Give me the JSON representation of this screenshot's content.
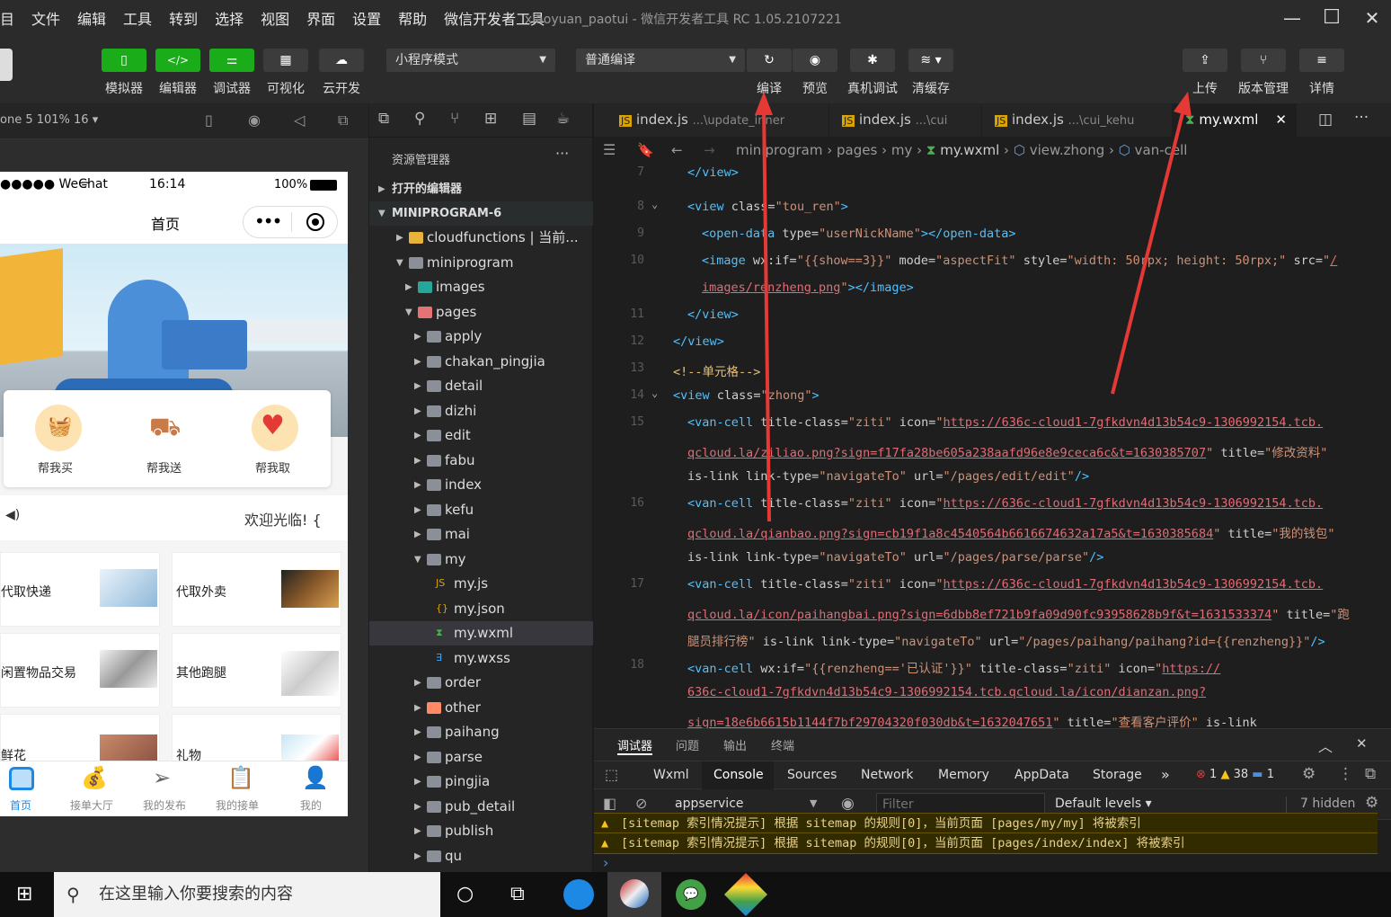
{
  "menu": [
    "目",
    "文件",
    "编辑",
    "工具",
    "转到",
    "选择",
    "视图",
    "界面",
    "设置",
    "帮助",
    "微信开发者工具"
  ],
  "window_title": "xiaoyuan_paotui - 微信开发者工具 RC 1.05.2107221",
  "toolbar": {
    "simulator": "模拟器",
    "editor": "编辑器",
    "debugger": "调试器",
    "visual": "可视化",
    "cloud": "云开发",
    "mode_select": "小程序模式",
    "compile_select": "普通编译",
    "compile": "编译",
    "preview": "预览",
    "real_debug": "真机调试",
    "clear_cache": "清缓存",
    "upload": "上传",
    "version": "版本管理",
    "details": "详情"
  },
  "sim_device": "one 5 101% 16 ▾",
  "phone": {
    "carrier": "●●●●● WeChat",
    "time": "16:14",
    "battery": "100%",
    "nav_title": "首页",
    "services": [
      "帮我买",
      "帮我送",
      "帮我取"
    ],
    "notice": "欢迎光临! {",
    "grid": [
      "代取快递",
      "代取外卖",
      "闲置物品交易",
      "其他跑腿",
      "鲜花",
      "礼物"
    ],
    "tabbar": [
      "首页",
      "接单大厅",
      "我的发布",
      "我的接单",
      "我的"
    ]
  },
  "explorer": {
    "title": "资源管理器",
    "open_editors": "打开的编辑器",
    "project": "MINIPROGRAM-6",
    "items": [
      {
        "label": "cloudfunctions | 当前...",
        "depth": 1,
        "kind": "folder-yellow",
        "arrow": "▶"
      },
      {
        "label": "miniprogram",
        "depth": 1,
        "kind": "folder",
        "arrow": "▼"
      },
      {
        "label": "images",
        "depth": 2,
        "kind": "folder-teal",
        "arrow": "▶"
      },
      {
        "label": "pages",
        "depth": 2,
        "kind": "folder-red",
        "arrow": "▼"
      },
      {
        "label": "apply",
        "depth": 3,
        "kind": "folder",
        "arrow": "▶"
      },
      {
        "label": "chakan_pingjia",
        "depth": 3,
        "kind": "folder",
        "arrow": "▶"
      },
      {
        "label": "detail",
        "depth": 3,
        "kind": "folder",
        "arrow": "▶"
      },
      {
        "label": "dizhi",
        "depth": 3,
        "kind": "folder",
        "arrow": "▶"
      },
      {
        "label": "edit",
        "depth": 3,
        "kind": "folder",
        "arrow": "▶"
      },
      {
        "label": "fabu",
        "depth": 3,
        "kind": "folder",
        "arrow": "▶"
      },
      {
        "label": "index",
        "depth": 3,
        "kind": "folder",
        "arrow": "▶"
      },
      {
        "label": "kefu",
        "depth": 3,
        "kind": "folder",
        "arrow": "▶"
      },
      {
        "label": "mai",
        "depth": 3,
        "kind": "folder",
        "arrow": "▶"
      },
      {
        "label": "my",
        "depth": 3,
        "kind": "folder",
        "arrow": "▼"
      },
      {
        "label": "my.js",
        "depth": 4,
        "kind": "js",
        "arrow": ""
      },
      {
        "label": "my.json",
        "depth": 4,
        "kind": "json",
        "arrow": ""
      },
      {
        "label": "my.wxml",
        "depth": 4,
        "kind": "wxml",
        "arrow": ""
      },
      {
        "label": "my.wxss",
        "depth": 4,
        "kind": "wxss",
        "arrow": ""
      },
      {
        "label": "order",
        "depth": 3,
        "kind": "folder",
        "arrow": "▶"
      },
      {
        "label": "other",
        "depth": 3,
        "kind": "folder-orange",
        "arrow": "▶"
      },
      {
        "label": "paihang",
        "depth": 3,
        "kind": "folder",
        "arrow": "▶"
      },
      {
        "label": "parse",
        "depth": 3,
        "kind": "folder",
        "arrow": "▶"
      },
      {
        "label": "pingjia",
        "depth": 3,
        "kind": "folder",
        "arrow": "▶"
      },
      {
        "label": "pub_detail",
        "depth": 3,
        "kind": "folder",
        "arrow": "▶"
      },
      {
        "label": "publish",
        "depth": 3,
        "kind": "folder",
        "arrow": "▶"
      },
      {
        "label": "qu",
        "depth": 3,
        "kind": "folder",
        "arrow": "▶"
      }
    ]
  },
  "tabs": [
    {
      "name": "index.js",
      "path": "...\\update_inner"
    },
    {
      "name": "index.js",
      "path": "...\\cui"
    },
    {
      "name": "index.js",
      "path": "...\\cui_kehu"
    },
    {
      "name": "my.wxml",
      "path": ""
    }
  ],
  "breadcrumb": [
    "miniprogram",
    "pages",
    "my",
    "my.wxml",
    "view.zhong",
    "van-cell"
  ],
  "code_lines": [
    {
      "n": "",
      "html": "<span class='tg'>&lt;/view&gt;</span>",
      "indent": 1
    },
    {
      "n": "8",
      "html": "<span class='tg'>&lt;view</span> <span class='at'>class=</span><span class='sv'>\"tou_ren\"</span><span class='tg'>&gt;</span>",
      "indent": 1
    },
    {
      "n": "9",
      "html": "<span class='tg'>&lt;open-data</span> <span class='at'>type=</span><span class='sv'>\"userNickName\"</span><span class='tg'>&gt;&lt;/open-data&gt;</span>",
      "indent": 2
    },
    {
      "n": "10",
      "html": "<span class='tg'>&lt;image</span> <span class='at'>wx:if=</span><span class='sv'>\"{{show==3}}\"</span> <span class='at'>mode=</span><span class='sv'>\"aspectFit\"</span> <span class='at'>style=</span><span class='sv'>\"width: 50rpx; height: 50rpx;\"</span> <span class='at'>src=</span><span class='sv'>\"</span><span class='url'>/</span>",
      "indent": 2
    },
    {
      "n": "",
      "html": "<span class='url'>images/renzheng.png</span><span class='sv'>\"</span><span class='tg'>&gt;&lt;/image&gt;</span>",
      "indent": 2
    },
    {
      "n": "11",
      "html": "<span class='tg'>&lt;/view&gt;</span>",
      "indent": 1
    },
    {
      "n": "12",
      "html": "<span class='tg'>&lt;/view&gt;</span>",
      "indent": 0
    },
    {
      "n": "13",
      "html": "<span class='cm'>&lt;!--单元格--&gt;</span>",
      "indent": 0
    },
    {
      "n": "14",
      "html": "<span class='tg'>&lt;view</span> <span class='at'>class=</span><span class='sv'>\"zhong\"</span><span class='tg'>&gt;</span>",
      "indent": 0
    },
    {
      "n": "15",
      "html": "<span class='tg'>&lt;van-cell</span> <span class='at'>title-class=</span><span class='sv'>\"ziti\"</span> <span class='at'>icon=</span><span class='sv'>\"</span><span class='url'>https://636c-cloud1-7gfkdvn4d13b54c9-1306992154.tcb.</span>",
      "indent": 1
    },
    {
      "n": "",
      "html": "<span class='url'>qcloud.la/ziliao.png?sign=f17fa28be605a238aafd96e8e9ceca6c&amp;t=1630385707</span><span class='sv'>\"</span> <span class='at'>title=</span><span class='sv'>\"修改资料\"</span>",
      "indent": 1
    },
    {
      "n": "",
      "html": "<span class='at'>is-link link-type=</span><span class='sv'>\"navigateTo\"</span> <span class='at'>url=</span><span class='sv'>\"/pages/edit/edit\"</span><span class='tg'>/&gt;</span>",
      "indent": 1
    },
    {
      "n": "16",
      "html": "<span class='tg'>&lt;van-cell</span> <span class='at'>title-class=</span><span class='sv'>\"ziti\"</span> <span class='at'>icon=</span><span class='sv'>\"</span><span class='url'>https://636c-cloud1-7gfkdvn4d13b54c9-1306992154.tcb.</span>",
      "indent": 1
    },
    {
      "n": "",
      "html": "<span class='url'>qcloud.la/qianbao.png?sign=cb19f1a8c4540564b6616674632a17a5&amp;t=1630385684</span><span class='sv'>\"</span> <span class='at'>title=</span><span class='sv'>\"我的钱包\"</span>",
      "indent": 1
    },
    {
      "n": "",
      "html": "<span class='at'>is-link link-type=</span><span class='sv'>\"navigateTo\"</span> <span class='at'>url=</span><span class='sv'>\"/pages/parse/parse\"</span><span class='tg'>/&gt;</span>",
      "indent": 1
    },
    {
      "n": "17",
      "html": "<span class='tg'>&lt;van-cell</span> <span class='at'>title-class=</span><span class='sv'>\"ziti\"</span> <span class='at'>icon=</span><span class='sv'>\"</span><span class='url'>https://636c-cloud1-7gfkdvn4d13b54c9-1306992154.tcb.</span>",
      "indent": 1
    },
    {
      "n": "",
      "html": "<span class='url'>qcloud.la/icon/paihangbai.png?sign=6dbb8ef721b9fa09d90fc93958628b9f&amp;t=1631533374</span><span class='sv'>\"</span> <span class='at'>title=</span><span class='sv'>\"跑</span>",
      "indent": 1
    },
    {
      "n": "",
      "html": "<span class='sv'>腿员排行榜\"</span> <span class='at'>is-link link-type=</span><span class='sv'>\"navigateTo\"</span> <span class='at'>url=</span><span class='sv'>\"/pages/paihang/paihang?id={{renzheng}}\"</span><span class='tg'>/&gt;</span>",
      "indent": 1
    },
    {
      "n": "18",
      "html": "<span class='tg'>&lt;van-cell</span> <span class='at'>wx:if=</span><span class='sv'>\"{{renzheng=='已认证'}}\"</span> <span class='at'>title-class=</span><span class='sv'>\"ziti\"</span> <span class='at'>icon=</span><span class='sv'>\"</span><span class='url'>https://</span>",
      "indent": 1
    },
    {
      "n": "",
      "html": "<span class='url'>636c-cloud1-7gfkdvn4d13b54c9-1306992154.tcb.qcloud.la/icon/dianzan.png?</span>",
      "indent": 1
    },
    {
      "n": "",
      "html": "<span class='url'>sign=18e6b6615b1144f7bf29704320f030db&amp;t=1632047651</span><span class='sv'>\"</span> <span class='at'>title=</span><span class='sv'>\"查看客户评价\"</span> <span class='at'>is-link</span>",
      "indent": 1
    }
  ],
  "first_line_number": "7",
  "devtools": {
    "panel_tabs": [
      "调试器",
      "问题",
      "输出",
      "终端"
    ],
    "tabs": [
      "Wxml",
      "Console",
      "Sources",
      "Network",
      "Memory",
      "AppData",
      "Storage"
    ],
    "more": "»",
    "errors": "1",
    "warnings": "38",
    "infos": "1",
    "context": "appservice",
    "filter_placeholder": "Filter",
    "levels": "Default levels ▾",
    "hidden": "7 hidden",
    "messages": [
      "[sitemap 索引情况提示] 根据 sitemap 的规则[0]，当前页面 [pages/my/my] 将被索引",
      "[sitemap 索引情况提示] 根据 sitemap 的规则[0]，当前页面 [pages/index/index] 将被索引"
    ],
    "prompt": "›"
  },
  "taskbar": {
    "search_placeholder": "在这里输入你要搜索的内容"
  },
  "colors": {
    "accent": "#1aad19",
    "arrow": "#e53935",
    "warn_bg": "#332b00"
  }
}
